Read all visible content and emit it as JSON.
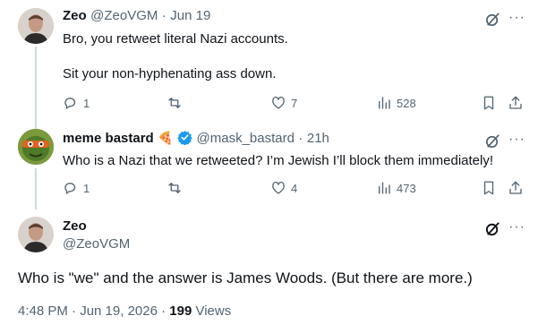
{
  "tweets": [
    {
      "name": "Zeo",
      "handle": "@ZeoVGM",
      "sep": "·",
      "time": "Jun 19",
      "lines": [
        "Bro, you retweet literal Nazi accounts.",
        "Sit your non-hyphenating ass down."
      ],
      "replies": "1",
      "retweets": "",
      "likes": "7",
      "views": "528"
    },
    {
      "name": "meme bastard",
      "emoji": "🍕",
      "handle": "@mask_bastard",
      "sep": "·",
      "time": "21h",
      "lines": [
        "Who is a Nazi that we retweeted? I’m Jewish I’ll block them immediately!"
      ],
      "replies": "1",
      "retweets": "",
      "likes": "4",
      "views": "473"
    }
  ],
  "main_tweet": {
    "name": "Zeo",
    "handle": "@ZeoVGM",
    "text": "Who is \"we\" and the answer is James Woods. (But there are more.)",
    "timestamp": "4:48 PM · Jun 19, 2026 ·",
    "views_count": "199",
    "views_label": "Views"
  },
  "colors": {
    "text": "#0f1419",
    "muted": "#536471",
    "verified": "#1d9bf0",
    "line": "#cfd9de"
  },
  "icons": [
    "grok-icon",
    "more-icon",
    "reply-icon",
    "retweet-icon",
    "like-icon",
    "views-icon",
    "bookmark-icon",
    "share-icon",
    "verified-icon"
  ]
}
